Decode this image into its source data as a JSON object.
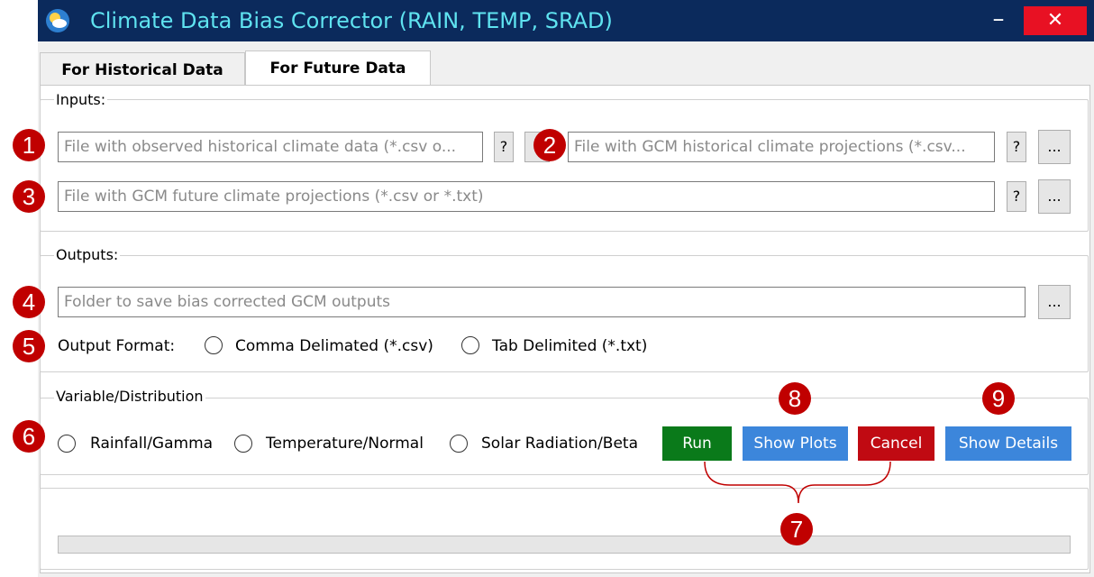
{
  "window": {
    "title": "Climate Data Bias Corrector (RAIN, TEMP, SRAD)",
    "minimize": "–",
    "close": "✕"
  },
  "tabs": [
    {
      "label": "For Historical Data"
    },
    {
      "label": "For Future Data"
    }
  ],
  "inputs": {
    "group_label": "Inputs:",
    "observed_placeholder": "File with observed historical climate data (*.csv o...",
    "gcm_hist_placeholder": "File with GCM historical climate projections (*.csv...",
    "gcm_future_placeholder": "File with GCM future climate projections (*.csv or *.txt)",
    "help_label": "?",
    "browse_label": "..."
  },
  "outputs": {
    "group_label": "Outputs:",
    "folder_placeholder": "Folder to save bias corrected GCM outputs",
    "browse_label": "...",
    "format_label": "Output Format:",
    "format_options": [
      "Comma Delimated (*.csv)",
      "Tab Delimited (*.txt)"
    ]
  },
  "variable": {
    "group_label": "Variable/Distribution",
    "options": [
      "Rainfall/Gamma",
      "Temperature/Normal",
      "Solar Radiation/Beta"
    ]
  },
  "actions": {
    "run": "Run",
    "show_plots": "Show Plots",
    "cancel": "Cancel",
    "show_details": "Show Details"
  },
  "annotations": [
    "1",
    "2",
    "3",
    "4",
    "5",
    "6",
    "7",
    "8",
    "9"
  ],
  "colors": {
    "titlebar": "#0b2a5c",
    "title_text": "#5fe3f0",
    "close": "#e81123",
    "run": "#0a7a1a",
    "show": "#3c86db",
    "cancel": "#c00a12",
    "badge": "#c00000"
  }
}
